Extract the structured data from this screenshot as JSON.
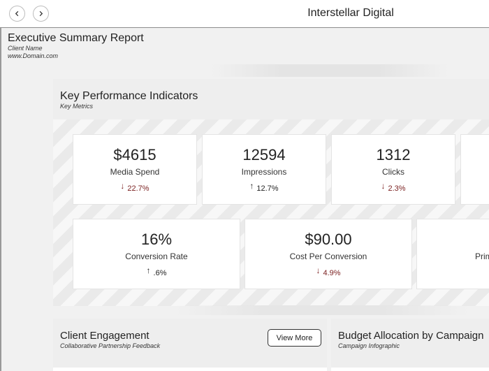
{
  "app": {
    "title": "Interstellar Digital"
  },
  "report": {
    "title": "Executive Summary Report",
    "client": "Client Name",
    "domain": "www.Domain.com"
  },
  "kpi": {
    "title": "Key Performance Indicators",
    "subtitle": "Key Metrics",
    "cards": [
      {
        "value": "$4615",
        "label": "Media Spend",
        "change": "22.7%",
        "direction": "down"
      },
      {
        "value": "12594",
        "label": "Impressions",
        "change": "12.7%",
        "direction": "up"
      },
      {
        "value": "1312",
        "label": "Clicks",
        "change": "2.3%",
        "direction": "down"
      },
      {
        "value": "16%",
        "label": "Conversion Rate",
        "change": ".6%",
        "direction": "up"
      },
      {
        "value": "$90.00",
        "label": "Cost Per Conversion",
        "change": "4.9%",
        "direction": "down"
      },
      {
        "label": "Prim"
      }
    ]
  },
  "engagement": {
    "title": "Client Engagement",
    "subtitle": "Collaborative Partnership Feedback",
    "button_label": "View More"
  },
  "budget": {
    "title": "Budget Allocation by Campaign",
    "subtitle": "Campaign Infographic"
  },
  "colors": {
    "down": "#7a1f1f",
    "up": "#222222",
    "accent_border": "#8c8c8c"
  },
  "icons": {
    "back": "chevron-left-icon",
    "forward": "chevron-right-icon",
    "down": "arrow-down-icon",
    "up": "arrow-up-icon"
  }
}
